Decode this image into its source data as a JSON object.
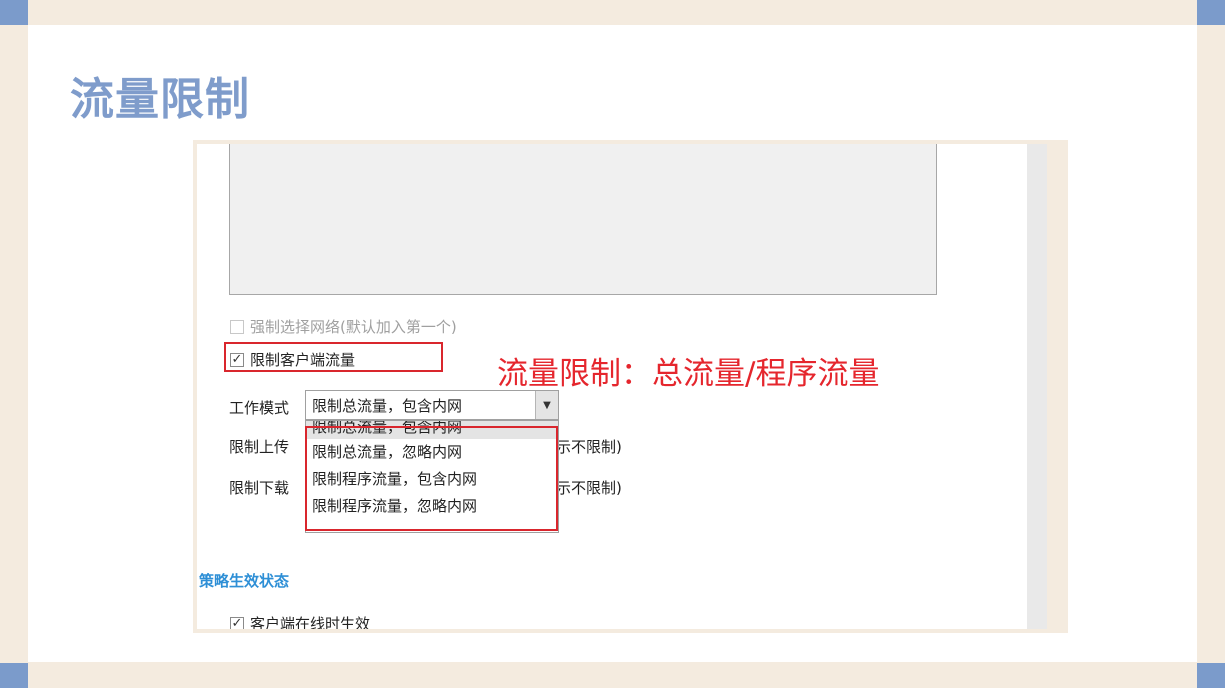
{
  "slide": {
    "title": "流量限制"
  },
  "form": {
    "force_network_label": "强制选择网络(默认加入第一个)",
    "force_network_checked": false,
    "limit_client_label": "限制客户端流量",
    "limit_client_checked": true,
    "work_mode_label": "工作模式",
    "work_mode_value": "限制总流量，包含内网",
    "work_mode_options": [
      "限制总流量，包含内网",
      "限制总流量，忽略内网",
      "限制程序流量，包含内网",
      "限制程序流量，忽略内网"
    ],
    "limit_upload_label": "限制上传",
    "limit_upload_suffix": "示不限制)",
    "limit_download_label": "限制下载",
    "limit_download_suffix": "示不限制)"
  },
  "policy": {
    "section_title": "策略生效状态",
    "online_label": "客户端在线时生效",
    "online_checked": true
  },
  "annotation": {
    "text": "流量限制：总流量/程序流量",
    "color": "#e5262d"
  },
  "icons": {
    "check": "check-icon",
    "dropdown_arrow": "chevron-down-icon"
  },
  "colors": {
    "title": "#7f9ccb",
    "frame": "#f4ebdf",
    "corner": "#7b9bcb",
    "highlight": "#d9262d",
    "section": "#2e8fd6"
  }
}
